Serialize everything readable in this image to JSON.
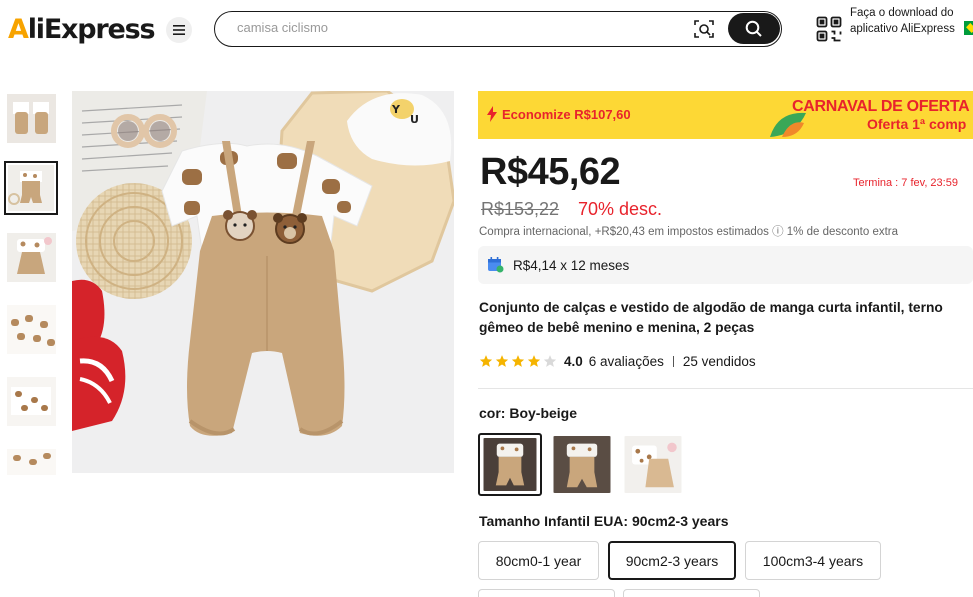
{
  "header": {
    "logo": "AliExpress",
    "search_placeholder": "camisa ciclismo",
    "app_download": "Faça o download do aplicativo AliExpress"
  },
  "gallery": {
    "thumbnails": [
      "thumb-1",
      "thumb-2",
      "thumb-3",
      "thumb-4",
      "thumb-5",
      "thumb-6"
    ],
    "active_index": 1
  },
  "banner": {
    "savings": "Economize R$107,60",
    "campaign": "CARNAVAL DE OFERTA",
    "campaign_sub": "Oferta 1ª comp",
    "color": "#fdd835",
    "text_color": "#e8232c"
  },
  "price": {
    "current": "R$45,62",
    "original": "R$153,22",
    "discount": "70% desc.",
    "ends": "Termina : 7 fev, 23:59",
    "international": "Compra internacional, +R$20,43 em impostos estimados ⓘ 1% de desconto extra"
  },
  "installments": {
    "text": "R$4,14 x 12 meses"
  },
  "product": {
    "title": "Conjunto de calças e vestido de algodão de manga curta infantil, terno gêmeo de bebê menino e menina, 2 peças"
  },
  "rating": {
    "score": "4.0",
    "stars_filled": 4,
    "stars_total": 5,
    "reviews": "6 avaliações",
    "sold": "25 vendidos"
  },
  "variants": {
    "color_label": "cor: Boy-beige",
    "colors": [
      "Boy-beige",
      "Boy-beige-2",
      "Girl-white"
    ],
    "selected_color_index": 0,
    "size_label": "Tamanho Infantil EUA: 90cm2-3 years",
    "sizes": [
      "80cm0-1 year",
      "90cm2-3 years",
      "100cm3-4 years"
    ],
    "selected_size_index": 1
  }
}
